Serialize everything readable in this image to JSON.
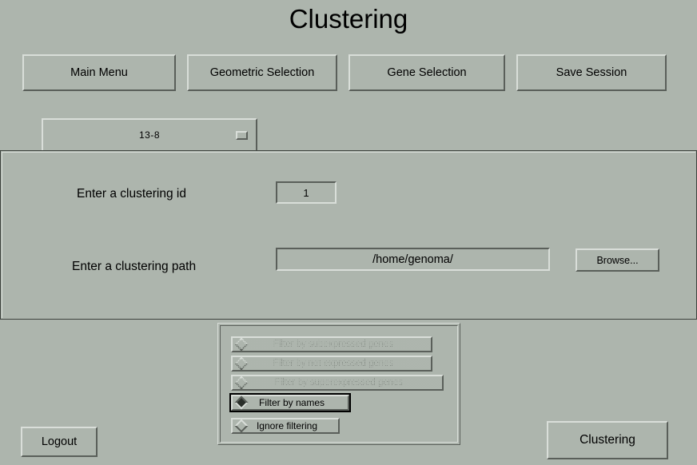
{
  "window": {
    "title": "Clustering"
  },
  "navbar": {
    "buttons": [
      {
        "label": "Main Menu"
      },
      {
        "label": "Geometric Selection"
      },
      {
        "label": "Gene Selection"
      },
      {
        "label": "Save Session"
      }
    ]
  },
  "session_selector": {
    "selected": "13-8",
    "indicator_icon": "option-menu-indicator-icon"
  },
  "form": {
    "clustering_id": {
      "label": "Enter a clustering id",
      "value": "1"
    },
    "clustering_path": {
      "label": "Enter a clustering path",
      "value": "/home/genoma/"
    },
    "browse_button": {
      "label": "Browse..."
    }
  },
  "filter_options": {
    "items": [
      {
        "label": "Filter by subexpressed genes",
        "selected": false,
        "disabled": true
      },
      {
        "label": "Filter by not expressed genes",
        "selected": false,
        "disabled": true
      },
      {
        "label": "Filter by superexpressed genes",
        "selected": false,
        "disabled": true
      },
      {
        "label": "Filter by names",
        "selected": true,
        "disabled": false
      },
      {
        "label": "Ignore filtering",
        "selected": false,
        "disabled": false
      }
    ]
  },
  "footer": {
    "logout_button": "Logout",
    "clustering_button": "Clustering"
  },
  "colors": {
    "background": "#adb5ad",
    "bevel_light": "#d9ded9",
    "bevel_dark": "#5a5f5a",
    "text": "#000000",
    "disabled_text": "#6e746e"
  }
}
